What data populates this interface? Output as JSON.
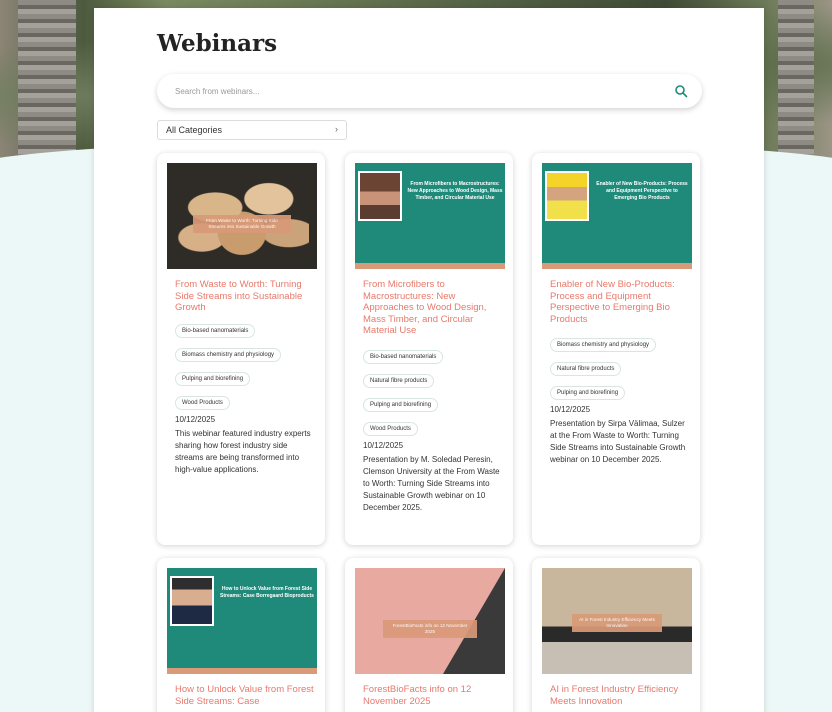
{
  "page": {
    "title": "Webinars",
    "search_placeholder": "Search from webinars...",
    "category_selected": "All Categories"
  },
  "cards": [
    {
      "title": "From Waste to Worth: Turning Side Streams into Sustainable Growth",
      "thumb_text": "From Waste to Worth: Turning Side Streams into Sustainable Growth",
      "tags": [
        "Bio-based nanomaterials",
        "Biomass chemistry and physiology",
        "Pulping and biorefining",
        "Wood Products"
      ],
      "date": "10/12/2025",
      "description": "This webinar featured industry experts sharing how forest industry side streams are being transformed into high-value applications."
    },
    {
      "title": "From Microfibers to Macrostructures: New Approaches to Wood Design, Mass Timber, and Circular Material Use",
      "thumb_text": "From Microfibers to Macrostructures: New Approaches to Wood Design, Mass Timber, and Circular Material Use",
      "tags": [
        "Bio-based nanomaterials",
        "Natural fibre products",
        "Pulping and biorefining",
        "Wood Products"
      ],
      "date": "10/12/2025",
      "description": "Presentation by M. Soledad Peresin, Clemson University at the From Waste to Worth: Turning Side Streams into Sustainable Growth webinar on 10 December 2025."
    },
    {
      "title": "Enabler of New Bio-Products: Process and Equipment Perspective to Emerging Bio Products",
      "thumb_text": "Enabler of New Bio-Products: Process and Equipment Perspective to Emerging Bio Products",
      "tags": [
        "Biomass chemistry and physiology",
        "Natural fibre products",
        "Pulping and biorefining"
      ],
      "date": "10/12/2025",
      "description": "Presentation by Sirpa Välimaa, Sulzer at the From Waste to Worth: Turning Side Streams into Sustainable Growth webinar on 10 December 2025."
    },
    {
      "title": "How to Unlock Value from Forest Side Streams: Case",
      "thumb_text": "How to Unlock Value from Forest Side Streams: Case Borregaard Bioproducts"
    },
    {
      "title": "ForestBioFacts info on 12 November 2025",
      "thumb_text": "ForestBioFacts info on 12 November 2025"
    },
    {
      "title": "AI in Forest Industry Efficiency Meets Innovation",
      "thumb_text": "AI in Forest Industry Efficiency Meets Innovation"
    }
  ],
  "colors": {
    "accent_title": "#e8796b",
    "teal": "#1f8a7a",
    "search_icon": "#1f8a7a"
  }
}
